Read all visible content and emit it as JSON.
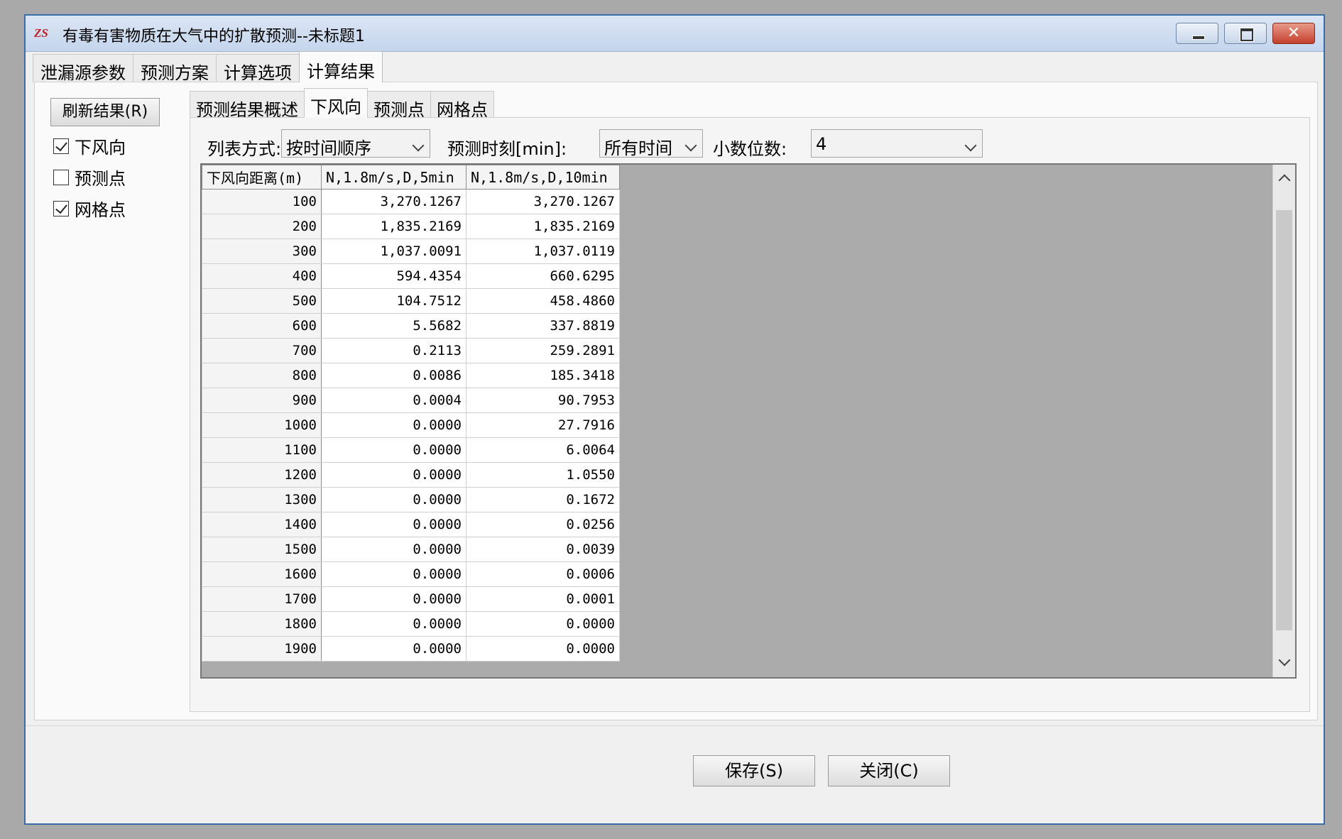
{
  "window": {
    "title": "有毒有害物质在大气中的扩散预测--未标题1",
    "icon": "app-logo-icon"
  },
  "main_tabs": [
    {
      "label": "泄漏源参数"
    },
    {
      "label": "预测方案"
    },
    {
      "label": "计算选项"
    },
    {
      "label": "计算结果"
    }
  ],
  "main_tabs_active": 3,
  "left_panel": {
    "refresh_label": "刷新结果(R)",
    "checkboxes": [
      {
        "label": "下风向",
        "checked": true
      },
      {
        "label": "预测点",
        "checked": false
      },
      {
        "label": "网格点",
        "checked": true
      }
    ]
  },
  "sub_tabs": [
    {
      "label": "预测结果概述"
    },
    {
      "label": "下风向"
    },
    {
      "label": "预测点"
    },
    {
      "label": "网格点"
    }
  ],
  "sub_tabs_active": 1,
  "toolbar": {
    "list_mode_label": "列表方式:",
    "list_mode_value": "按时间顺序",
    "time_label": "预测时刻[min]:",
    "time_value": "所有时间",
    "decimals_label": "小数位数:",
    "decimals_value": "4"
  },
  "table": {
    "headers": [
      "下风向距离(m)",
      "N,1.8m/s,D,5min",
      "N,1.8m/s,D,10min"
    ],
    "rows": [
      [
        "100",
        "3,270.1267",
        "3,270.1267"
      ],
      [
        "200",
        "1,835.2169",
        "1,835.2169"
      ],
      [
        "300",
        "1,037.0091",
        "1,037.0119"
      ],
      [
        "400",
        "594.4354",
        "660.6295"
      ],
      [
        "500",
        "104.7512",
        "458.4860"
      ],
      [
        "600",
        "5.5682",
        "337.8819"
      ],
      [
        "700",
        "0.2113",
        "259.2891"
      ],
      [
        "800",
        "0.0086",
        "185.3418"
      ],
      [
        "900",
        "0.0004",
        "90.7953"
      ],
      [
        "1000",
        "0.0000",
        "27.7916"
      ],
      [
        "1100",
        "0.0000",
        "6.0064"
      ],
      [
        "1200",
        "0.0000",
        "1.0550"
      ],
      [
        "1300",
        "0.0000",
        "0.1672"
      ],
      [
        "1400",
        "0.0000",
        "0.0256"
      ],
      [
        "1500",
        "0.0000",
        "0.0039"
      ],
      [
        "1600",
        "0.0000",
        "0.0006"
      ],
      [
        "1700",
        "0.0000",
        "0.0001"
      ],
      [
        "1800",
        "0.0000",
        "0.0000"
      ],
      [
        "1900",
        "0.0000",
        "0.0000"
      ]
    ]
  },
  "buttons": {
    "save_label": "保存(S)",
    "close_label": "关闭(C)"
  },
  "colors": {
    "title_bar": "#c4d5ec",
    "grid_background": "#ababab",
    "close_button": "#c4402c"
  }
}
